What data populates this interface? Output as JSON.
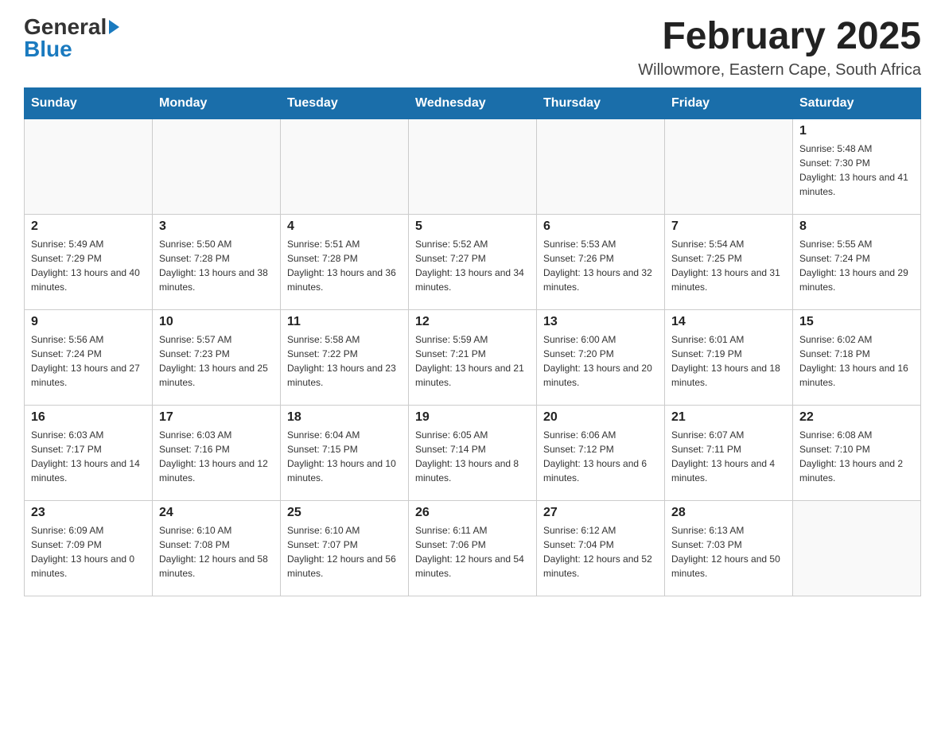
{
  "header": {
    "logo": {
      "general": "General",
      "blue": "Blue"
    },
    "title": "February 2025",
    "subtitle": "Willowmore, Eastern Cape, South Africa"
  },
  "calendar": {
    "days_of_week": [
      "Sunday",
      "Monday",
      "Tuesday",
      "Wednesday",
      "Thursday",
      "Friday",
      "Saturday"
    ],
    "weeks": [
      [
        {
          "day": "",
          "info": ""
        },
        {
          "day": "",
          "info": ""
        },
        {
          "day": "",
          "info": ""
        },
        {
          "day": "",
          "info": ""
        },
        {
          "day": "",
          "info": ""
        },
        {
          "day": "",
          "info": ""
        },
        {
          "day": "1",
          "info": "Sunrise: 5:48 AM\nSunset: 7:30 PM\nDaylight: 13 hours and 41 minutes."
        }
      ],
      [
        {
          "day": "2",
          "info": "Sunrise: 5:49 AM\nSunset: 7:29 PM\nDaylight: 13 hours and 40 minutes."
        },
        {
          "day": "3",
          "info": "Sunrise: 5:50 AM\nSunset: 7:28 PM\nDaylight: 13 hours and 38 minutes."
        },
        {
          "day": "4",
          "info": "Sunrise: 5:51 AM\nSunset: 7:28 PM\nDaylight: 13 hours and 36 minutes."
        },
        {
          "day": "5",
          "info": "Sunrise: 5:52 AM\nSunset: 7:27 PM\nDaylight: 13 hours and 34 minutes."
        },
        {
          "day": "6",
          "info": "Sunrise: 5:53 AM\nSunset: 7:26 PM\nDaylight: 13 hours and 32 minutes."
        },
        {
          "day": "7",
          "info": "Sunrise: 5:54 AM\nSunset: 7:25 PM\nDaylight: 13 hours and 31 minutes."
        },
        {
          "day": "8",
          "info": "Sunrise: 5:55 AM\nSunset: 7:24 PM\nDaylight: 13 hours and 29 minutes."
        }
      ],
      [
        {
          "day": "9",
          "info": "Sunrise: 5:56 AM\nSunset: 7:24 PM\nDaylight: 13 hours and 27 minutes."
        },
        {
          "day": "10",
          "info": "Sunrise: 5:57 AM\nSunset: 7:23 PM\nDaylight: 13 hours and 25 minutes."
        },
        {
          "day": "11",
          "info": "Sunrise: 5:58 AM\nSunset: 7:22 PM\nDaylight: 13 hours and 23 minutes."
        },
        {
          "day": "12",
          "info": "Sunrise: 5:59 AM\nSunset: 7:21 PM\nDaylight: 13 hours and 21 minutes."
        },
        {
          "day": "13",
          "info": "Sunrise: 6:00 AM\nSunset: 7:20 PM\nDaylight: 13 hours and 20 minutes."
        },
        {
          "day": "14",
          "info": "Sunrise: 6:01 AM\nSunset: 7:19 PM\nDaylight: 13 hours and 18 minutes."
        },
        {
          "day": "15",
          "info": "Sunrise: 6:02 AM\nSunset: 7:18 PM\nDaylight: 13 hours and 16 minutes."
        }
      ],
      [
        {
          "day": "16",
          "info": "Sunrise: 6:03 AM\nSunset: 7:17 PM\nDaylight: 13 hours and 14 minutes."
        },
        {
          "day": "17",
          "info": "Sunrise: 6:03 AM\nSunset: 7:16 PM\nDaylight: 13 hours and 12 minutes."
        },
        {
          "day": "18",
          "info": "Sunrise: 6:04 AM\nSunset: 7:15 PM\nDaylight: 13 hours and 10 minutes."
        },
        {
          "day": "19",
          "info": "Sunrise: 6:05 AM\nSunset: 7:14 PM\nDaylight: 13 hours and 8 minutes."
        },
        {
          "day": "20",
          "info": "Sunrise: 6:06 AM\nSunset: 7:12 PM\nDaylight: 13 hours and 6 minutes."
        },
        {
          "day": "21",
          "info": "Sunrise: 6:07 AM\nSunset: 7:11 PM\nDaylight: 13 hours and 4 minutes."
        },
        {
          "day": "22",
          "info": "Sunrise: 6:08 AM\nSunset: 7:10 PM\nDaylight: 13 hours and 2 minutes."
        }
      ],
      [
        {
          "day": "23",
          "info": "Sunrise: 6:09 AM\nSunset: 7:09 PM\nDaylight: 13 hours and 0 minutes."
        },
        {
          "day": "24",
          "info": "Sunrise: 6:10 AM\nSunset: 7:08 PM\nDaylight: 12 hours and 58 minutes."
        },
        {
          "day": "25",
          "info": "Sunrise: 6:10 AM\nSunset: 7:07 PM\nDaylight: 12 hours and 56 minutes."
        },
        {
          "day": "26",
          "info": "Sunrise: 6:11 AM\nSunset: 7:06 PM\nDaylight: 12 hours and 54 minutes."
        },
        {
          "day": "27",
          "info": "Sunrise: 6:12 AM\nSunset: 7:04 PM\nDaylight: 12 hours and 52 minutes."
        },
        {
          "day": "28",
          "info": "Sunrise: 6:13 AM\nSunset: 7:03 PM\nDaylight: 12 hours and 50 minutes."
        },
        {
          "day": "",
          "info": ""
        }
      ]
    ]
  }
}
